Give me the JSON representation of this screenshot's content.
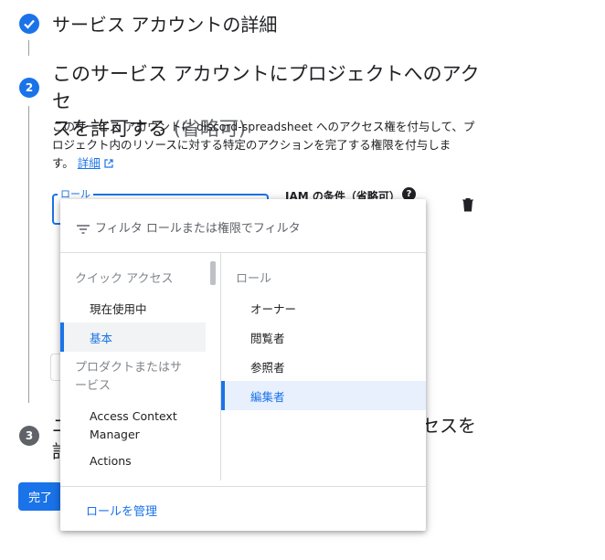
{
  "step1": {
    "title": "サービス アカウントの詳細"
  },
  "step2": {
    "number": "2",
    "title_line1": "このサービス アカウントにプロジェクトへのアクセ",
    "title_line2": "スを許可する",
    "title_optional": "(省略可)",
    "desc_line1": "このサービス アカウントに discord-spreadsheet へのアクセス権を付与して、プ",
    "desc_line2": "ロジェクト内のリソースに対する特定のアクションを完了する権限を付与しま",
    "desc_line3": "す。",
    "details_link": "詳細",
    "role_label": "ロール",
    "iam_condition_label": "IAM の条件（省略可）"
  },
  "step3": {
    "number": "3",
    "title_right_fragment": "セスを",
    "title_left_fragment1": "ユ",
    "title_left_fragment2": "許"
  },
  "done_button": "完了",
  "dropdown": {
    "filter_placeholder": "フィルタ ロールまたは権限でフィルタ",
    "left_header_quick": "クイック アクセス",
    "quick_items": [
      "現在使用中",
      "基本"
    ],
    "left_header_products_line1": "プロダクトまたはサ",
    "left_header_products_line2": "ービス",
    "product_items": [
      {
        "line1": "Access Context",
        "line2": "Manager"
      },
      {
        "line1": "Actions"
      }
    ],
    "right_header": "ロール",
    "roles": [
      "オーナー",
      "閲覧者",
      "参照者",
      "編集者"
    ],
    "selected_category": "基本",
    "selected_role": "編集者",
    "manage_roles_link": "ロールを管理"
  },
  "colors": {
    "accent": "#1a73e8",
    "step_inactive": "#5f6368"
  }
}
